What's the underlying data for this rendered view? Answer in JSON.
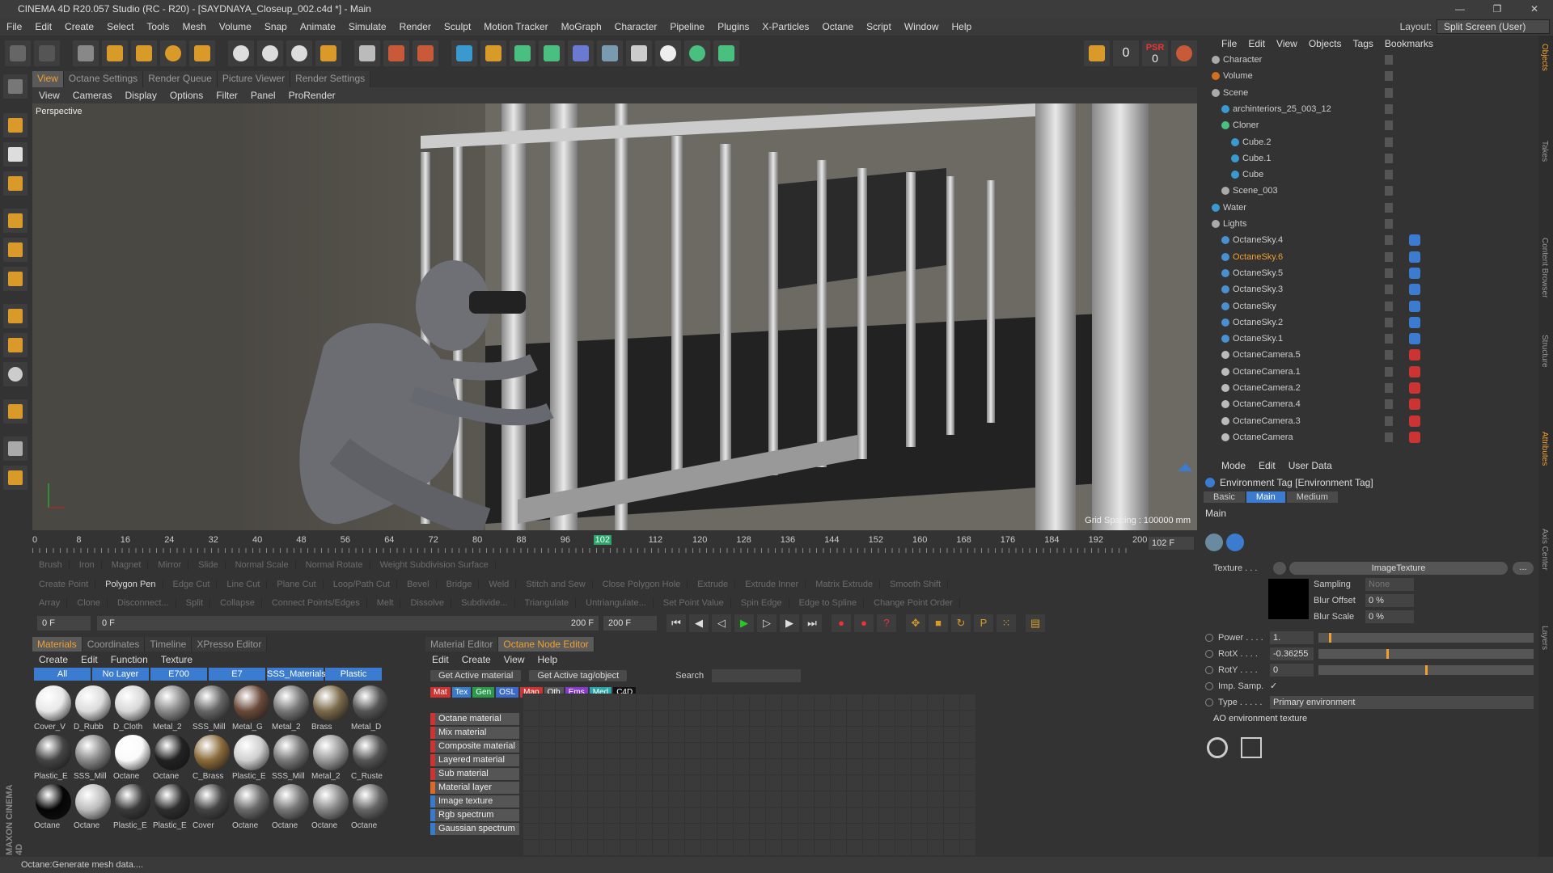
{
  "window": {
    "title": "CINEMA 4D R20.057 Studio (RC - R20) - [SAYDNAYA_Closeup_002.c4d *] - Main",
    "controls": [
      "—",
      "❐",
      "✕"
    ]
  },
  "menubar": [
    "File",
    "Edit",
    "Create",
    "Select",
    "Tools",
    "Mesh",
    "Volume",
    "Snap",
    "Animate",
    "Simulate",
    "Render",
    "Sculpt",
    "Motion Tracker",
    "MoGraph",
    "Character",
    "Pipeline",
    "Plugins",
    "X-Particles",
    "Octane",
    "Script",
    "Window",
    "Help"
  ],
  "layout": {
    "label": "Layout:",
    "value": "Split Screen (User)"
  },
  "toolbar": {
    "psr_label": "PSR",
    "psr_value": "0",
    "lock_value": "0"
  },
  "viewport": {
    "tabs": [
      "View",
      "Octane Settings",
      "Render Queue",
      "Picture Viewer",
      "Render Settings"
    ],
    "active_tab": "View",
    "menu": [
      "View",
      "Cameras",
      "Display",
      "Options",
      "Filter",
      "Panel",
      "ProRender"
    ],
    "label": "Perspective",
    "grid_spacing": "Grid Spacing : 100000 mm"
  },
  "timeline": {
    "ticks": [
      "0",
      "8",
      "16",
      "24",
      "32",
      "40",
      "48",
      "56",
      "64",
      "72",
      "80",
      "88",
      "96",
      "102",
      "112",
      "120",
      "128",
      "136",
      "144",
      "152",
      "160",
      "168",
      "176",
      "184",
      "192",
      "200"
    ],
    "current": "102",
    "frame_field": "102 F"
  },
  "modebars": [
    [
      "Brush",
      "Iron",
      "Magnet",
      "Mirror",
      "Slide",
      "Normal Scale",
      "Normal Rotate",
      "Weight Subdivision Surface"
    ],
    [
      "Create Point",
      "Polygon Pen",
      "Edge Cut",
      "Line Cut",
      "Plane Cut",
      "Loop/Path Cut",
      "Bevel",
      "Bridge",
      "Weld",
      "Stitch and Sew",
      "Close Polygon Hole",
      "Extrude",
      "Extrude Inner",
      "Matrix Extrude",
      "Smooth Shift"
    ],
    [
      "Array",
      "Clone",
      "Disconnect...",
      "Split",
      "Collapse",
      "Connect Points/Edges",
      "Melt",
      "Dissolve",
      "Subdivide...",
      "Triangulate",
      "Untriangulate...",
      "Set Point Value",
      "Spin Edge",
      "Edge to Spline",
      "Change Point Order"
    ]
  ],
  "transport": {
    "start": "0 F",
    "range_start": "0 F",
    "range_end": "200 F",
    "end": "200 F"
  },
  "materials": {
    "tabs": [
      "Materials",
      "Coordinates",
      "Timeline",
      "XPresso Editor"
    ],
    "menu": [
      "Create",
      "Edit",
      "Function",
      "Texture"
    ],
    "layers": [
      "All",
      "No Layer",
      "E700",
      "E7",
      "SSS_Materials",
      "Plastic"
    ],
    "items": [
      {
        "name": "Cover_V",
        "color": "#e8e8e8"
      },
      {
        "name": "D_Rubb",
        "color": "#dcdcdc"
      },
      {
        "name": "D_Cloth",
        "color": "#d8d8d8"
      },
      {
        "name": "Metal_2",
        "color": "#8a8a8a"
      },
      {
        "name": "SSS_Mill",
        "color": "#666"
      },
      {
        "name": "Metal_G",
        "color": "#6a4a3a"
      },
      {
        "name": "Metal_2",
        "color": "#777"
      },
      {
        "name": "Brass",
        "color": "#7a6a4a"
      },
      {
        "name": "Metal_D",
        "color": "#555"
      },
      {
        "name": "Plastic_E",
        "color": "#444"
      },
      {
        "name": "SSS_Mill",
        "color": "#888"
      },
      {
        "name": "Octane",
        "color": "#fafafa"
      },
      {
        "name": "Octane",
        "color": "#222"
      },
      {
        "name": "C_Brass",
        "color": "#8a6a3a"
      },
      {
        "name": "Plastic_E",
        "color": "#cfcfcf"
      },
      {
        "name": "SSS_Mill",
        "color": "#777"
      },
      {
        "name": "Metal_2",
        "color": "#999"
      },
      {
        "name": "C_Ruste",
        "color": "#555"
      },
      {
        "name": "Octane",
        "color": "#050505"
      },
      {
        "name": "Octane",
        "color": "#bdbdbd"
      },
      {
        "name": "Plastic_E",
        "color": "#3a3a3a"
      },
      {
        "name": "Plastic_E",
        "color": "#2e2e2e"
      },
      {
        "name": "Cover",
        "color": "#444"
      },
      {
        "name": "Octane",
        "color": "#6a6a6a"
      },
      {
        "name": "Octane",
        "color": "#777"
      },
      {
        "name": "Octane",
        "color": "#888"
      },
      {
        "name": "Octane",
        "color": "#666"
      }
    ]
  },
  "node_editor": {
    "tabs": [
      "Material Editor",
      "Octane Node Editor"
    ],
    "menu": [
      "Edit",
      "Create",
      "View",
      "Help"
    ],
    "buttons": [
      "Get Active material",
      "Get Active tag/object"
    ],
    "search_label": "Search",
    "categories": [
      {
        "name": "Mat",
        "color": "#c33"
      },
      {
        "name": "Tex",
        "color": "#3a7acb"
      },
      {
        "name": "Gen",
        "color": "#2a9a4a"
      },
      {
        "name": "OSL",
        "color": "#3a6acb"
      },
      {
        "name": "Map",
        "color": "#c33"
      },
      {
        "name": "Oth",
        "color": "#555"
      },
      {
        "name": "Ems",
        "color": "#8a3acb"
      },
      {
        "name": "Med",
        "color": "#2aa6a6"
      },
      {
        "name": "C4D",
        "color": "#111"
      }
    ],
    "nodes": [
      {
        "name": "Octane material",
        "color": "#c33"
      },
      {
        "name": "Mix material",
        "color": "#c33"
      },
      {
        "name": "Composite material",
        "color": "#c33"
      },
      {
        "name": "Layered material",
        "color": "#c33"
      },
      {
        "name": "Sub material",
        "color": "#c33"
      },
      {
        "name": "Material layer",
        "color": "#d96a2a"
      },
      {
        "name": "Image texture",
        "color": "#3a7acb"
      },
      {
        "name": "Rgb spectrum",
        "color": "#3a7acb"
      },
      {
        "name": "Gaussian spectrum",
        "color": "#3a7acb"
      }
    ]
  },
  "objects": {
    "menu": [
      "File",
      "Edit",
      "View",
      "Objects",
      "Tags",
      "Bookmarks"
    ],
    "items": [
      {
        "name": "Character",
        "indent": 0,
        "color": "#aaa",
        "highlight": false
      },
      {
        "name": "Volume",
        "indent": 0,
        "color": "#d07020",
        "highlight": false
      },
      {
        "name": "Scene",
        "indent": 0,
        "color": "#aaa",
        "highlight": false
      },
      {
        "name": "archinteriors_25_003_12",
        "indent": 1,
        "color": "#3a9ad0",
        "highlight": false
      },
      {
        "name": "Cloner",
        "indent": 1,
        "color": "#4ac080",
        "highlight": false
      },
      {
        "name": "Cube.2",
        "indent": 2,
        "color": "#3a9ad0",
        "highlight": false
      },
      {
        "name": "Cube.1",
        "indent": 2,
        "color": "#3a9ad0",
        "highlight": false
      },
      {
        "name": "Cube",
        "indent": 2,
        "color": "#3a9ad0",
        "highlight": false
      },
      {
        "name": "Scene_003",
        "indent": 1,
        "color": "#aaa",
        "highlight": false
      },
      {
        "name": "Water",
        "indent": 0,
        "color": "#3a9ad0",
        "highlight": false
      },
      {
        "name": "Lights",
        "indent": 0,
        "color": "#aaa",
        "highlight": false
      },
      {
        "name": "OctaneSky.4",
        "indent": 1,
        "color": "#4a90d0",
        "highlight": false
      },
      {
        "name": "OctaneSky.6",
        "indent": 1,
        "color": "#4a90d0",
        "highlight": true
      },
      {
        "name": "OctaneSky.5",
        "indent": 1,
        "color": "#4a90d0",
        "highlight": false
      },
      {
        "name": "OctaneSky.3",
        "indent": 1,
        "color": "#4a90d0",
        "highlight": false
      },
      {
        "name": "OctaneSky",
        "indent": 1,
        "color": "#4a90d0",
        "highlight": false
      },
      {
        "name": "OctaneSky.2",
        "indent": 1,
        "color": "#4a90d0",
        "highlight": false
      },
      {
        "name": "OctaneSky.1",
        "indent": 1,
        "color": "#4a90d0",
        "highlight": false
      },
      {
        "name": "OctaneCamera.5",
        "indent": 1,
        "color": "#bbb",
        "highlight": false
      },
      {
        "name": "OctaneCamera.1",
        "indent": 1,
        "color": "#bbb",
        "highlight": false
      },
      {
        "name": "OctaneCamera.2",
        "indent": 1,
        "color": "#bbb",
        "highlight": false
      },
      {
        "name": "OctaneCamera.4",
        "indent": 1,
        "color": "#bbb",
        "highlight": false
      },
      {
        "name": "OctaneCamera.3",
        "indent": 1,
        "color": "#bbb",
        "highlight": false
      },
      {
        "name": "OctaneCamera",
        "indent": 1,
        "color": "#bbb",
        "highlight": false
      }
    ]
  },
  "attributes": {
    "menu": [
      "Mode",
      "Edit",
      "User Data"
    ],
    "title": "Environment Tag [Environment Tag]",
    "tabs": [
      "Basic",
      "Main",
      "Medium"
    ],
    "active_tab": "Main",
    "section": "Main",
    "texture_label": "Texture . . .",
    "texture_value": "ImageTexture",
    "texture_more": "...",
    "sampling_label": "Sampling",
    "sampling_value": "None",
    "blur_offset_label": "Blur Offset",
    "blur_offset_value": "0 %",
    "blur_scale_label": "Blur Scale",
    "blur_scale_value": "0 %",
    "power_label": "Power . . . .",
    "power_value": "1.",
    "power_level": 0.05,
    "rotx_label": "RotX . . . .",
    "rotx_value": "-0.36255",
    "rotx_level": 0.32,
    "roty_label": "RotY . . . .",
    "roty_value": "0",
    "roty_level": 0.5,
    "imp_label": "Imp. Samp.",
    "imp_value": "✓",
    "type_label": "Type . . . . .",
    "type_value": "Primary environment",
    "ao_label": "AO environment texture"
  },
  "right_strip": [
    "Objects",
    "Takes",
    "Content Browser",
    "Structure",
    "Attributes",
    "Axis Center",
    "Layers"
  ],
  "status": "Octane:Generate mesh data....",
  "brand": "MAXON CINEMA 4D"
}
